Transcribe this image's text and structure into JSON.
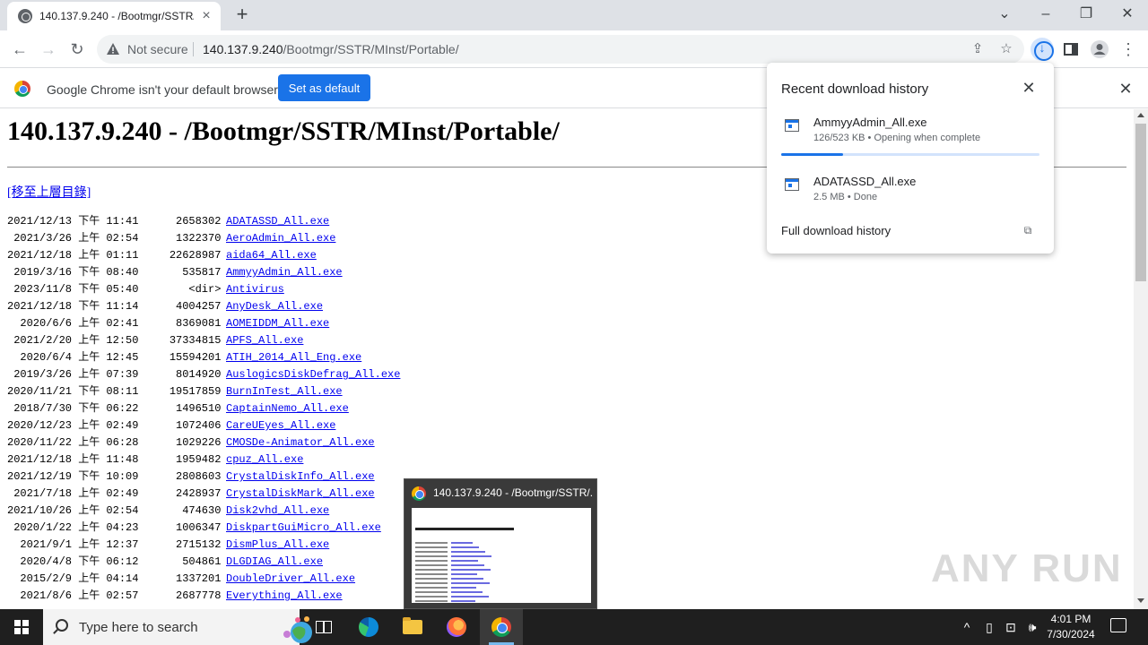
{
  "browser": {
    "tab": {
      "title": "140.137.9.240 - /Bootmgr/SSTR/MInst/Portable/"
    },
    "omnibox": {
      "security_label": "Not secure",
      "url_host": "140.137.9.240",
      "url_path": "/Bootmgr/SSTR/MInst/Portable/"
    },
    "infobar": {
      "message": "Google Chrome isn't your default browser",
      "button": "Set as default"
    }
  },
  "page": {
    "heading": "140.137.9.240 - /Bootmgr/SSTR/MInst/Portable/",
    "parent_link": "[移至上層目錄]",
    "entries": [
      {
        "date": "2021/12/13 下午 11:41",
        "size": "2658302",
        "name": "ADATASSD_All.exe"
      },
      {
        "date": " 2021/3/26 上午 02:54",
        "size": "1322370",
        "name": "AeroAdmin_All.exe"
      },
      {
        "date": "2021/12/18 上午 01:11",
        "size": "22628987",
        "name": "aida64_All.exe"
      },
      {
        "date": " 2019/3/16 下午 08:40",
        "size": "535817",
        "name": "AmmyyAdmin_All.exe"
      },
      {
        "date": " 2023/11/8 下午 05:40",
        "size": "<dir>",
        "name": "Antivirus"
      },
      {
        "date": "2021/12/18 下午 11:14",
        "size": "4004257",
        "name": "AnyDesk_All.exe"
      },
      {
        "date": "  2020/6/6 上午 02:41",
        "size": "8369081",
        "name": "AOMEIDDM_All.exe"
      },
      {
        "date": " 2021/2/20 上午 12:50",
        "size": "37334815",
        "name": "APFS_All.exe"
      },
      {
        "date": "  2020/6/4 上午 12:45",
        "size": "15594201",
        "name": "ATIH_2014_All_Eng.exe"
      },
      {
        "date": " 2019/3/26 上午 07:39",
        "size": "8014920",
        "name": "AuslogicsDiskDefrag_All.exe"
      },
      {
        "date": "2020/11/21 下午 08:11",
        "size": "19517859",
        "name": "BurnInTest_All.exe"
      },
      {
        "date": " 2018/7/30 下午 06:22",
        "size": "1496510",
        "name": "CaptainNemo_All.exe"
      },
      {
        "date": "2020/12/23 上午 02:49",
        "size": "1072406",
        "name": "CareUEyes_All.exe"
      },
      {
        "date": "2020/11/22 上午 06:28",
        "size": "1029226",
        "name": "CMOSDe-Animator_All.exe"
      },
      {
        "date": "2021/12/18 上午 11:48",
        "size": "1959482",
        "name": "cpuz_All.exe"
      },
      {
        "date": "2021/12/19 下午 10:09",
        "size": "2808603",
        "name": "CrystalDiskInfo_All.exe"
      },
      {
        "date": " 2021/7/18 上午 02:49",
        "size": "2428937",
        "name": "CrystalDiskMark_All.exe"
      },
      {
        "date": "2021/10/26 上午 02:54",
        "size": "474630",
        "name": "Disk2vhd_All.exe"
      },
      {
        "date": " 2020/1/22 上午 04:23",
        "size": "1006347",
        "name": "DiskpartGuiMicro_All.exe"
      },
      {
        "date": "  2021/9/1 上午 12:37",
        "size": "2715132",
        "name": "DismPlus_All.exe"
      },
      {
        "date": "  2020/4/8 下午 06:12",
        "size": "504861",
        "name": "DLGDIAG_All.exe"
      },
      {
        "date": "  2015/2/9 上午 04:14",
        "size": "1337201",
        "name": "DoubleDriver_All.exe"
      },
      {
        "date": "  2021/8/6 上午 02:57",
        "size": "2687778",
        "name": "Everything_All.exe"
      }
    ]
  },
  "downloads": {
    "title": "Recent download history",
    "items": [
      {
        "name": "AmmyyAdmin_All.exe",
        "status": "126/523 KB • Opening when complete",
        "progress": 0.24
      },
      {
        "name": "ADATASSD_All.exe",
        "status": "2.5 MB • Done"
      }
    ],
    "full_history": "Full download history"
  },
  "thumbnail_preview": {
    "title": "140.137.9.240 - /Bootmgr/SSTR/..."
  },
  "watermark": "ANY RUN",
  "taskbar": {
    "search_placeholder": "Type here to search",
    "time": "4:01 PM",
    "date": "7/30/2024"
  },
  "colors": {
    "accent": "#1a73e8",
    "link": "#0000ee",
    "taskbar": "#1f1f1f"
  }
}
